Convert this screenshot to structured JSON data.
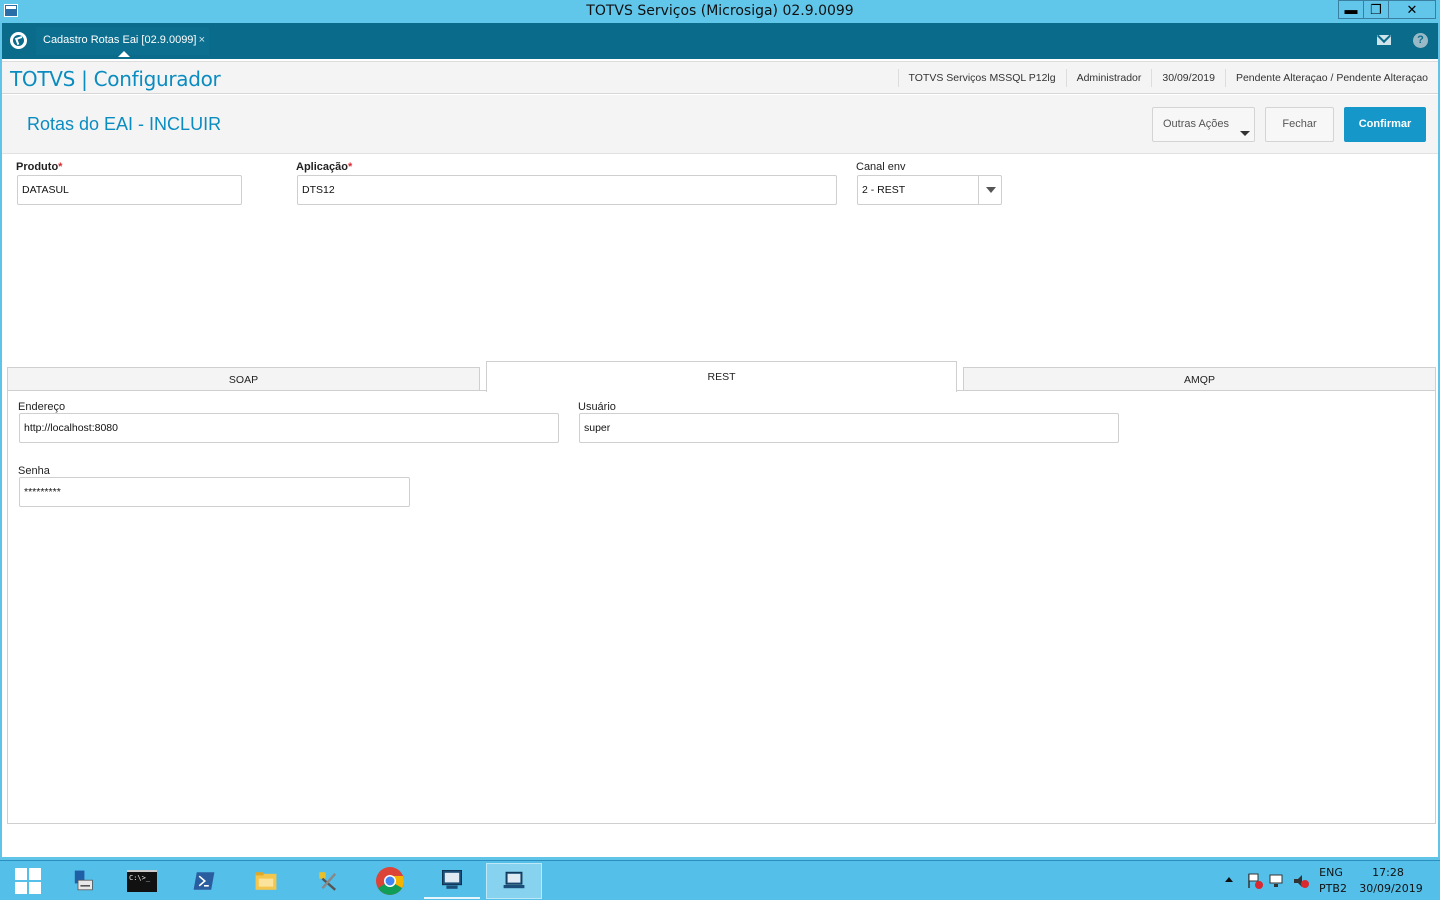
{
  "window": {
    "title": "TOTVS Serviços (Microsiga) 02.9.0099",
    "minimize": "▬",
    "restore": "❐",
    "close": "✕"
  },
  "app_tab": {
    "label": "Cadastro Rotas Eai [02.9.0099]",
    "close": "×"
  },
  "help_label": "?",
  "header": {
    "brand": "TOTVS | Configurador",
    "environment": "TOTVS Serviços MSSQL P12lg",
    "user": "Administrador",
    "date": "30/09/2019",
    "status": "Pendente Alteraçao / Pendente Alteraçao"
  },
  "page": {
    "title": "Rotas do EAI - INCLUIR",
    "outras_acoes": "Outras Ações",
    "fechar": "Fechar",
    "confirmar": "Confirmar"
  },
  "form": {
    "produto_label": "Produto",
    "produto_value": "DATASUL",
    "aplicacao_label": "Aplicação",
    "aplicacao_value": "DTS12",
    "canal_label": "Canal env",
    "canal_value": "2 - REST",
    "required_mark": "*"
  },
  "tabs": [
    {
      "label": "SOAP",
      "active": false
    },
    {
      "label": "REST",
      "active": true
    },
    {
      "label": "AMQP",
      "active": false
    }
  ],
  "rest": {
    "endereco_label": "Endereço",
    "endereco_value": "http://localhost:8080",
    "usuario_label": "Usuário",
    "usuario_value": "super",
    "senha_label": "Senha",
    "senha_value": "*********"
  },
  "taskbar": {
    "cmd_text": "C:\\>_",
    "lang": "ENG",
    "layout": "PTB2",
    "time": "17:28",
    "date": "30/09/2019"
  },
  "colors": {
    "accent": "#0b8cc0",
    "primary_button": "#1597c9",
    "app_bar": "#0a6b8b",
    "title_bar": "#60c6ea"
  }
}
